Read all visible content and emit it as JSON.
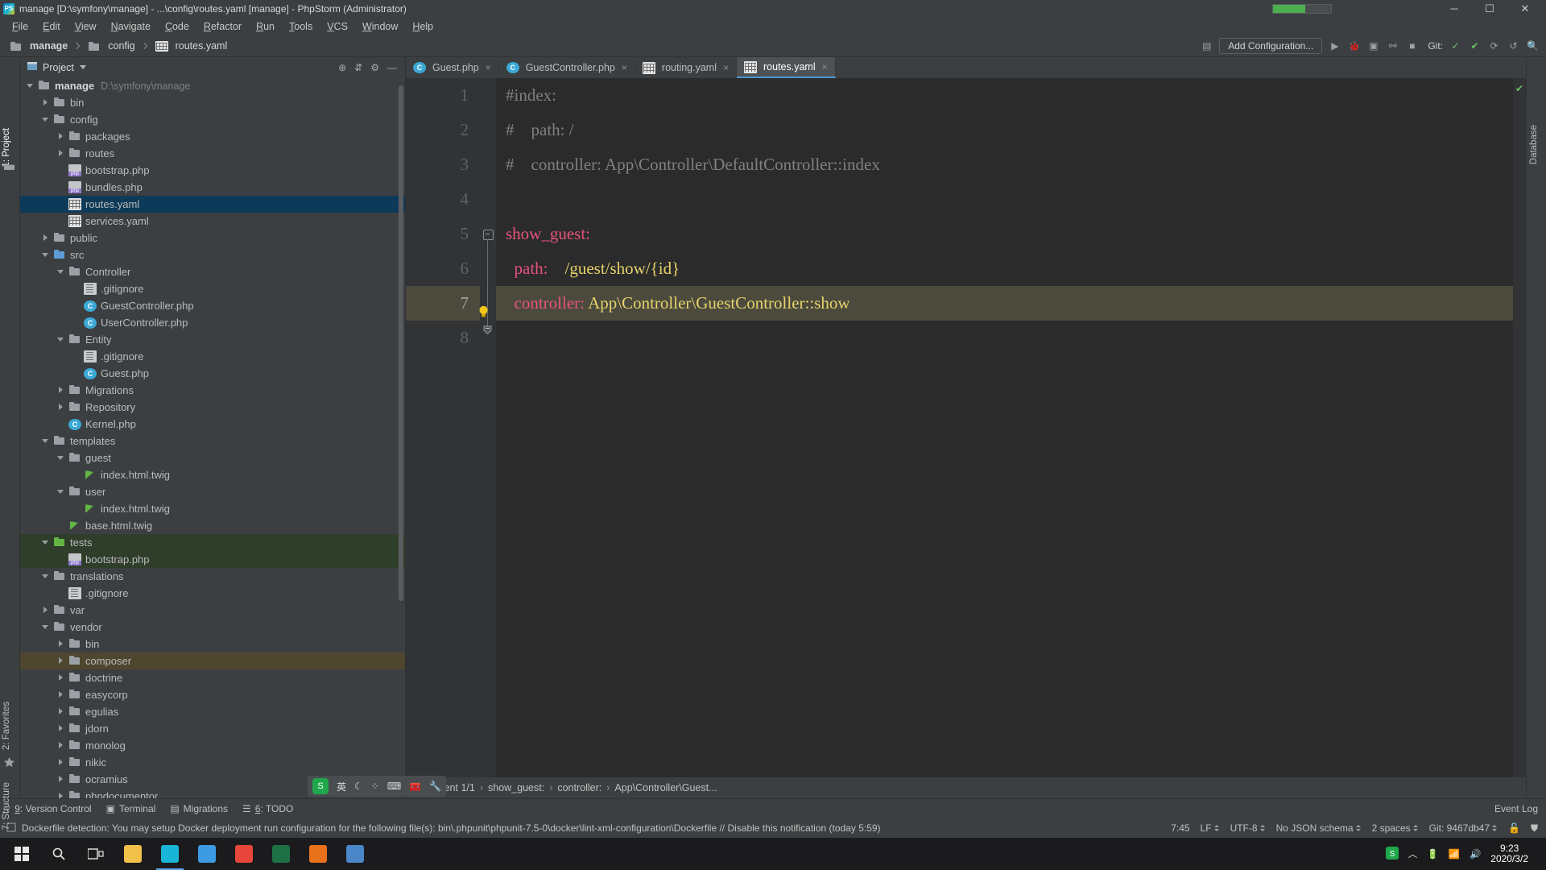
{
  "window": {
    "title": "manage [D:\\symfony\\manage] - ...\\config\\routes.yaml [manage] - PhpStorm (Administrator)",
    "app_badge": "PS",
    "minimize": "─",
    "maximize": "☐",
    "close": "✕"
  },
  "menu": [
    "File",
    "Edit",
    "View",
    "Navigate",
    "Code",
    "Refactor",
    "Run",
    "Tools",
    "VCS",
    "Window",
    "Help"
  ],
  "navbar": {
    "breadcrumbs": [
      "manage",
      "config",
      "routes.yaml"
    ],
    "add_configuration": "Add Configuration...",
    "git_label": "Git:",
    "icons": [
      "preview-icon",
      "run-icon",
      "debug-icon",
      "coverage-icon",
      "profile-icon",
      "stop-icon",
      "check-icon",
      "commit-icon",
      "update-icon",
      "undo-icon",
      "search-everywhere-icon"
    ]
  },
  "left_strip": {
    "project_tab": "1: Project",
    "favorites_tab": "2: Favorites",
    "structure_tab": "7: Structure"
  },
  "right_strip": {
    "database_tab": "Database"
  },
  "project_panel": {
    "title": "Project",
    "header_icons": [
      "locate-icon",
      "collapse-all-icon",
      "settings-gear-icon",
      "hide-icon"
    ],
    "tree": [
      {
        "depth": 0,
        "arrow": "down",
        "icon": "folder",
        "label": "manage",
        "path": "D:\\symfony\\manage",
        "bold": true,
        "state": "none"
      },
      {
        "depth": 1,
        "arrow": "right",
        "icon": "folder",
        "label": "bin",
        "path": "",
        "bold": false,
        "state": "none"
      },
      {
        "depth": 1,
        "arrow": "down",
        "icon": "folder",
        "label": "config",
        "path": "",
        "bold": false,
        "state": "none"
      },
      {
        "depth": 2,
        "arrow": "right",
        "icon": "folder",
        "label": "packages",
        "path": "",
        "bold": false,
        "state": "none"
      },
      {
        "depth": 2,
        "arrow": "right",
        "icon": "folder",
        "label": "routes",
        "path": "",
        "bold": false,
        "state": "none"
      },
      {
        "depth": 2,
        "arrow": "none",
        "icon": "php",
        "label": "bootstrap.php",
        "path": "",
        "bold": false,
        "state": "none"
      },
      {
        "depth": 2,
        "arrow": "none",
        "icon": "php",
        "label": "bundles.php",
        "path": "",
        "bold": false,
        "state": "none"
      },
      {
        "depth": 2,
        "arrow": "none",
        "icon": "yaml",
        "label": "routes.yaml",
        "path": "",
        "bold": false,
        "state": "selected"
      },
      {
        "depth": 2,
        "arrow": "none",
        "icon": "yaml",
        "label": "services.yaml",
        "path": "",
        "bold": false,
        "state": "none"
      },
      {
        "depth": 1,
        "arrow": "right",
        "icon": "folder",
        "label": "public",
        "path": "",
        "bold": false,
        "state": "none"
      },
      {
        "depth": 1,
        "arrow": "down",
        "icon": "folder-blue",
        "label": "src",
        "path": "",
        "bold": false,
        "state": "none"
      },
      {
        "depth": 2,
        "arrow": "down",
        "icon": "folder",
        "label": "Controller",
        "path": "",
        "bold": false,
        "state": "none"
      },
      {
        "depth": 3,
        "arrow": "none",
        "icon": "git",
        "label": ".gitignore",
        "path": "",
        "bold": false,
        "state": "none"
      },
      {
        "depth": 3,
        "arrow": "none",
        "icon": "class",
        "label": "GuestController.php",
        "path": "",
        "bold": false,
        "state": "none"
      },
      {
        "depth": 3,
        "arrow": "none",
        "icon": "class",
        "label": "UserController.php",
        "path": "",
        "bold": false,
        "state": "none"
      },
      {
        "depth": 2,
        "arrow": "down",
        "icon": "folder",
        "label": "Entity",
        "path": "",
        "bold": false,
        "state": "none"
      },
      {
        "depth": 3,
        "arrow": "none",
        "icon": "git",
        "label": ".gitignore",
        "path": "",
        "bold": false,
        "state": "none"
      },
      {
        "depth": 3,
        "arrow": "none",
        "icon": "class",
        "label": "Guest.php",
        "path": "",
        "bold": false,
        "state": "none"
      },
      {
        "depth": 2,
        "arrow": "right",
        "icon": "folder",
        "label": "Migrations",
        "path": "",
        "bold": false,
        "state": "none"
      },
      {
        "depth": 2,
        "arrow": "right",
        "icon": "folder",
        "label": "Repository",
        "path": "",
        "bold": false,
        "state": "none"
      },
      {
        "depth": 2,
        "arrow": "none",
        "icon": "class",
        "label": "Kernel.php",
        "path": "",
        "bold": false,
        "state": "none"
      },
      {
        "depth": 1,
        "arrow": "down",
        "icon": "folder",
        "label": "templates",
        "path": "",
        "bold": false,
        "state": "none"
      },
      {
        "depth": 2,
        "arrow": "down",
        "icon": "folder",
        "label": "guest",
        "path": "",
        "bold": false,
        "state": "none"
      },
      {
        "depth": 3,
        "arrow": "none",
        "icon": "twig",
        "label": "index.html.twig",
        "path": "",
        "bold": false,
        "state": "none"
      },
      {
        "depth": 2,
        "arrow": "down",
        "icon": "folder",
        "label": "user",
        "path": "",
        "bold": false,
        "state": "none"
      },
      {
        "depth": 3,
        "arrow": "none",
        "icon": "twig",
        "label": "index.html.twig",
        "path": "",
        "bold": false,
        "state": "none"
      },
      {
        "depth": 2,
        "arrow": "none",
        "icon": "twig",
        "label": "base.html.twig",
        "path": "",
        "bold": false,
        "state": "none"
      },
      {
        "depth": 1,
        "arrow": "down",
        "icon": "folder-green",
        "label": "tests",
        "path": "",
        "bold": false,
        "state": "green"
      },
      {
        "depth": 2,
        "arrow": "none",
        "icon": "php",
        "label": "bootstrap.php",
        "path": "",
        "bold": false,
        "state": "green"
      },
      {
        "depth": 1,
        "arrow": "down",
        "icon": "folder",
        "label": "translations",
        "path": "",
        "bold": false,
        "state": "none"
      },
      {
        "depth": 2,
        "arrow": "none",
        "icon": "git",
        "label": ".gitignore",
        "path": "",
        "bold": false,
        "state": "none"
      },
      {
        "depth": 1,
        "arrow": "right",
        "icon": "folder",
        "label": "var",
        "path": "",
        "bold": false,
        "state": "none"
      },
      {
        "depth": 1,
        "arrow": "down",
        "icon": "folder",
        "label": "vendor",
        "path": "",
        "bold": false,
        "state": "none"
      },
      {
        "depth": 2,
        "arrow": "right",
        "icon": "folder",
        "label": "bin",
        "path": "",
        "bold": false,
        "state": "none"
      },
      {
        "depth": 2,
        "arrow": "right",
        "icon": "folder",
        "label": "composer",
        "path": "",
        "bold": false,
        "state": "brown"
      },
      {
        "depth": 2,
        "arrow": "right",
        "icon": "folder",
        "label": "doctrine",
        "path": "",
        "bold": false,
        "state": "none"
      },
      {
        "depth": 2,
        "arrow": "right",
        "icon": "folder",
        "label": "easycorp",
        "path": "",
        "bold": false,
        "state": "none"
      },
      {
        "depth": 2,
        "arrow": "right",
        "icon": "folder",
        "label": "egulias",
        "path": "",
        "bold": false,
        "state": "none"
      },
      {
        "depth": 2,
        "arrow": "right",
        "icon": "folder",
        "label": "jdorn",
        "path": "",
        "bold": false,
        "state": "none"
      },
      {
        "depth": 2,
        "arrow": "right",
        "icon": "folder",
        "label": "monolog",
        "path": "",
        "bold": false,
        "state": "none"
      },
      {
        "depth": 2,
        "arrow": "right",
        "icon": "folder",
        "label": "nikic",
        "path": "",
        "bold": false,
        "state": "none"
      },
      {
        "depth": 2,
        "arrow": "right",
        "icon": "folder",
        "label": "ocramius",
        "path": "",
        "bold": false,
        "state": "none"
      },
      {
        "depth": 2,
        "arrow": "right",
        "icon": "folder",
        "label": "phpdocumentor",
        "path": "",
        "bold": false,
        "state": "none"
      }
    ]
  },
  "editor": {
    "tabs": [
      {
        "label": "Guest.php",
        "icon": "class-icon",
        "active": false
      },
      {
        "label": "GuestController.php",
        "icon": "class-icon",
        "active": false
      },
      {
        "label": "routing.yaml",
        "icon": "yaml-icon",
        "active": false
      },
      {
        "label": "routes.yaml",
        "icon": "yaml-icon",
        "active": true
      }
    ],
    "close_glyph": "×",
    "current_line": 7,
    "lines": [
      {
        "n": "1",
        "segments": [
          {
            "t": "#index:",
            "c": "comment"
          }
        ]
      },
      {
        "n": "2",
        "segments": [
          {
            "t": "#    path: /",
            "c": "comment"
          }
        ]
      },
      {
        "n": "3",
        "segments": [
          {
            "t": "#    controller: App\\Controller\\DefaultController::index",
            "c": "comment"
          }
        ]
      },
      {
        "n": "4",
        "segments": [
          {
            "t": "",
            "c": "text"
          }
        ]
      },
      {
        "n": "5",
        "segments": [
          {
            "t": "show_guest:",
            "c": "key"
          }
        ]
      },
      {
        "n": "6",
        "segments": [
          {
            "t": "  path:    ",
            "c": "key"
          },
          {
            "t": "/guest/show/{id}",
            "c": "val"
          }
        ]
      },
      {
        "n": "7",
        "segments": [
          {
            "t": "  controller: ",
            "c": "key"
          },
          {
            "t": "App\\Controller\\GuestController::show",
            "c": "val"
          }
        ]
      },
      {
        "n": "8",
        "segments": [
          {
            "t": "",
            "c": "text"
          }
        ]
      }
    ]
  },
  "doc_bar": {
    "document": "Document 1/1",
    "crumbs": [
      "show_guest:",
      "controller:",
      "App\\Controller\\Guest..."
    ]
  },
  "bottom_tools": [
    {
      "label": "9: Version Control",
      "icon": "vcs-icon"
    },
    {
      "label": "Terminal",
      "icon": "terminal-icon"
    },
    {
      "label": "Migrations",
      "icon": "migrations-icon"
    },
    {
      "label": "6: TODO",
      "icon": "todo-icon"
    }
  ],
  "bottom_right": {
    "event_log": "Event Log"
  },
  "status_bar": {
    "notification": "Dockerfile detection: You may setup Docker deployment run configuration for the following file(s): bin\\.phpunit\\phpunit-7.5-0\\docker\\lint-xml-configuration\\Dockerfile // Disable this notification (today 5:59)",
    "caret": "7:45",
    "line_sep": "LF",
    "encoding": "UTF-8",
    "schema": "No JSON schema",
    "indent": "2 spaces",
    "git_branch": "Git: 9467db47",
    "lock_icon": "lock-icon",
    "inspection_icon": "inspections-icon"
  },
  "ime": {
    "logo": "S",
    "mode": "英",
    "items": [
      "moon-icon",
      "dots-icon",
      "keyboard-icon",
      "toolbox-icon",
      "wrench-icon"
    ]
  },
  "taskbar": {
    "start": "start-icon",
    "search": "search-icon",
    "taskview": "task-view-icon",
    "apps": [
      {
        "name": "explorer",
        "color": "#f2c14a"
      },
      {
        "name": "phpstorm",
        "color": "#19b5d6",
        "active": true
      },
      {
        "name": "edge",
        "color": "#3b9ae1"
      },
      {
        "name": "chrome",
        "color": "#e8453c"
      },
      {
        "name": "excel",
        "color": "#1e7145"
      },
      {
        "name": "firefox",
        "color": "#e8721c"
      },
      {
        "name": "notepad",
        "color": "#4a86c8"
      }
    ],
    "tray_icons": [
      "sogou-icon",
      "battery-icon",
      "network-icon",
      "volume-icon",
      "show-hidden-icon"
    ],
    "time": "9:23",
    "date": "2020/3/2"
  },
  "colors": {
    "accent": "#4a97d2",
    "panel_bg": "#3c3f41",
    "editor_bg": "#2b2b2b",
    "selection_blue": "#0d3a58",
    "key_pink": "#e8537f",
    "value_yellow": "#e8d36b",
    "comment_gray": "#808080",
    "current_line": "#4b4a3d"
  }
}
